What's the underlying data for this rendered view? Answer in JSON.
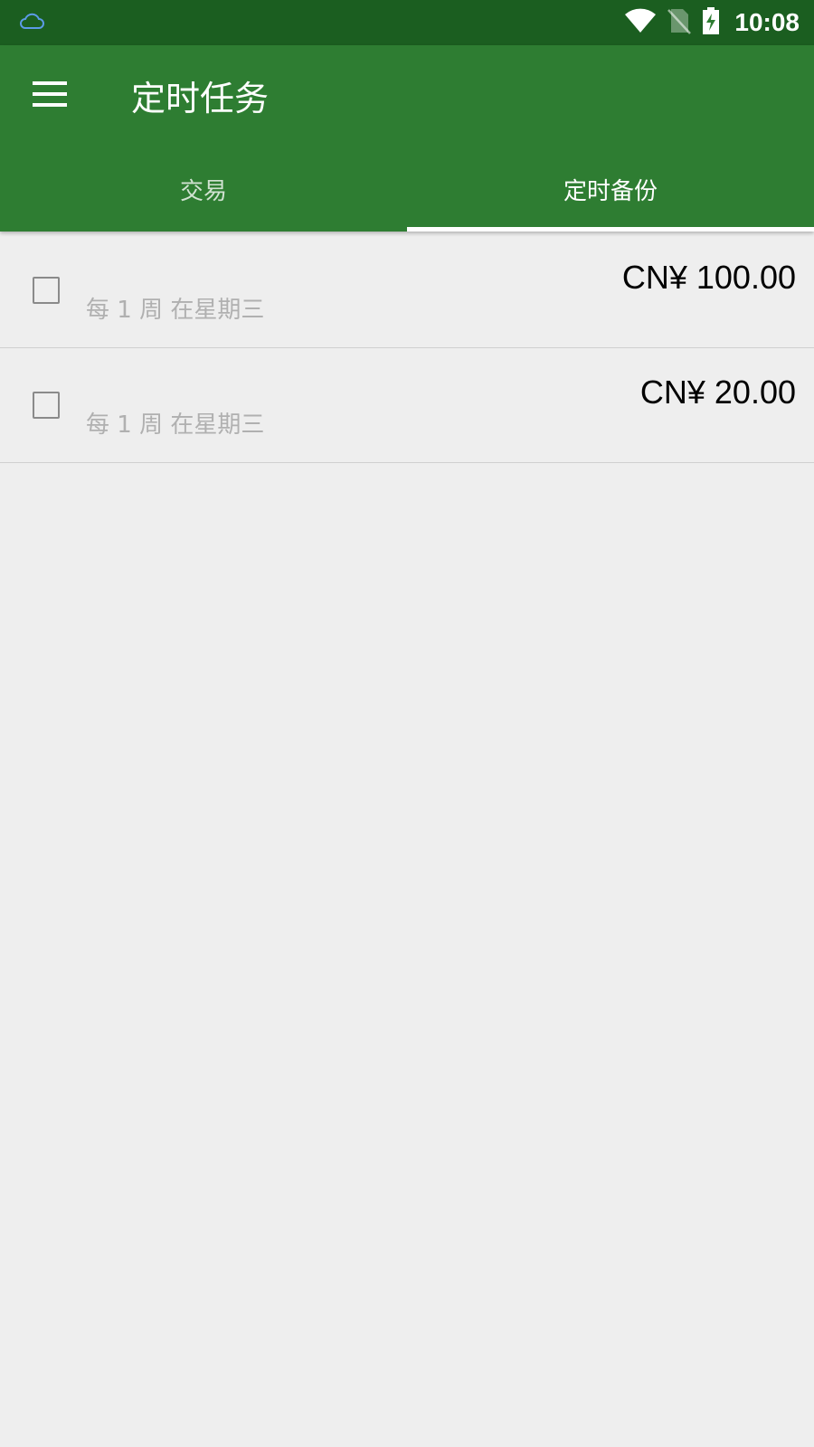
{
  "status_bar": {
    "time": "10:08",
    "icons": [
      "cloud-icon",
      "wifi-icon",
      "no-sim-icon",
      "battery-charging-icon"
    ]
  },
  "app_bar": {
    "title": "定时任务",
    "menu_icon": "menu-icon"
  },
  "tabs": [
    {
      "label": "交易",
      "active": false
    },
    {
      "label": "定时备份",
      "active": true
    }
  ],
  "items": [
    {
      "amount": "CN¥ 100.00",
      "schedule": "每 1 周 在星期三",
      "checked": false
    },
    {
      "amount": "CN¥ 20.00",
      "schedule": "每 1 周 在星期三",
      "checked": false
    }
  ],
  "colors": {
    "status_bar": "#1b5e20",
    "app_bar": "#2e7d32",
    "background": "#eeeeee",
    "subtext": "#b0b0b0"
  }
}
